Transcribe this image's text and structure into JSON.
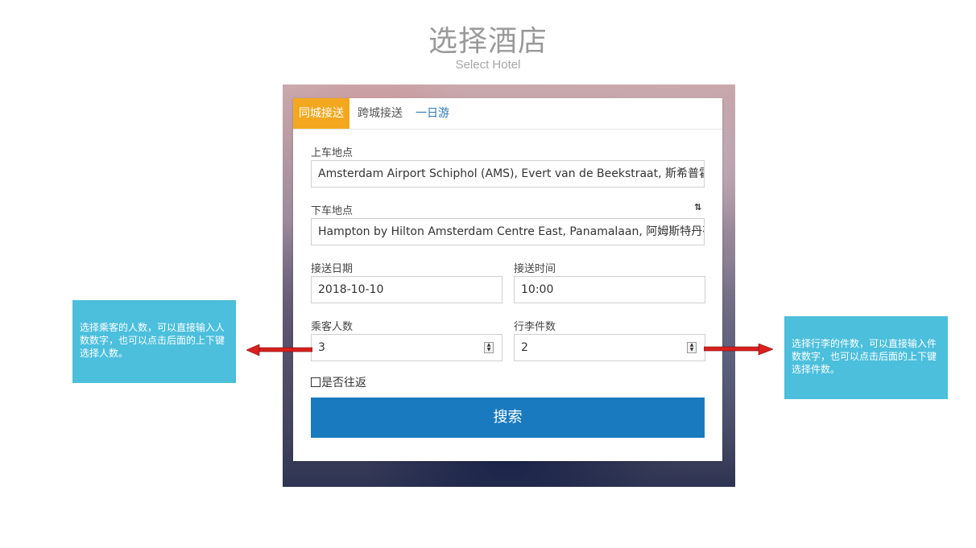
{
  "page": {
    "title": "选择酒店",
    "subtitle": "Select Hotel"
  },
  "tabs": [
    {
      "label": "同城接送",
      "active": true
    },
    {
      "label": "跨城接送",
      "active": false
    },
    {
      "label": "一日游",
      "active": false
    }
  ],
  "form": {
    "pickup": {
      "label": "上车地点",
      "value": "Amsterdam Airport Schiphol (AMS), Evert van de Beekstraat, 斯希普霍尔"
    },
    "dropoff": {
      "label": "下车地点",
      "value": "Hampton by Hilton Amsterdam Centre East, Panamalaan, 阿姆斯特丹荷兰"
    },
    "swap_icon": "⇅",
    "date": {
      "label": "接送日期",
      "value": "2018-10-10"
    },
    "time": {
      "label": "接送时间",
      "value": "10:00"
    },
    "passengers": {
      "label": "乘客人数",
      "value": "3"
    },
    "luggage": {
      "label": "行李件数",
      "value": "2"
    },
    "round_trip": {
      "label": "是否往返",
      "checked": false
    },
    "search_label": "搜索"
  },
  "notes": {
    "left": "选择乘客的人数，可以直接输入人数数字，也可以点击后面的上下键选择人数。",
    "right": "选择行李的件数，可以直接输入件数数字，也可以点击后面的上下键选择件数。"
  },
  "colors": {
    "accent_tab": "#f3a81f",
    "button": "#1a7abf",
    "note_bg": "#4bbfdc",
    "arrow": "#d9201e"
  }
}
